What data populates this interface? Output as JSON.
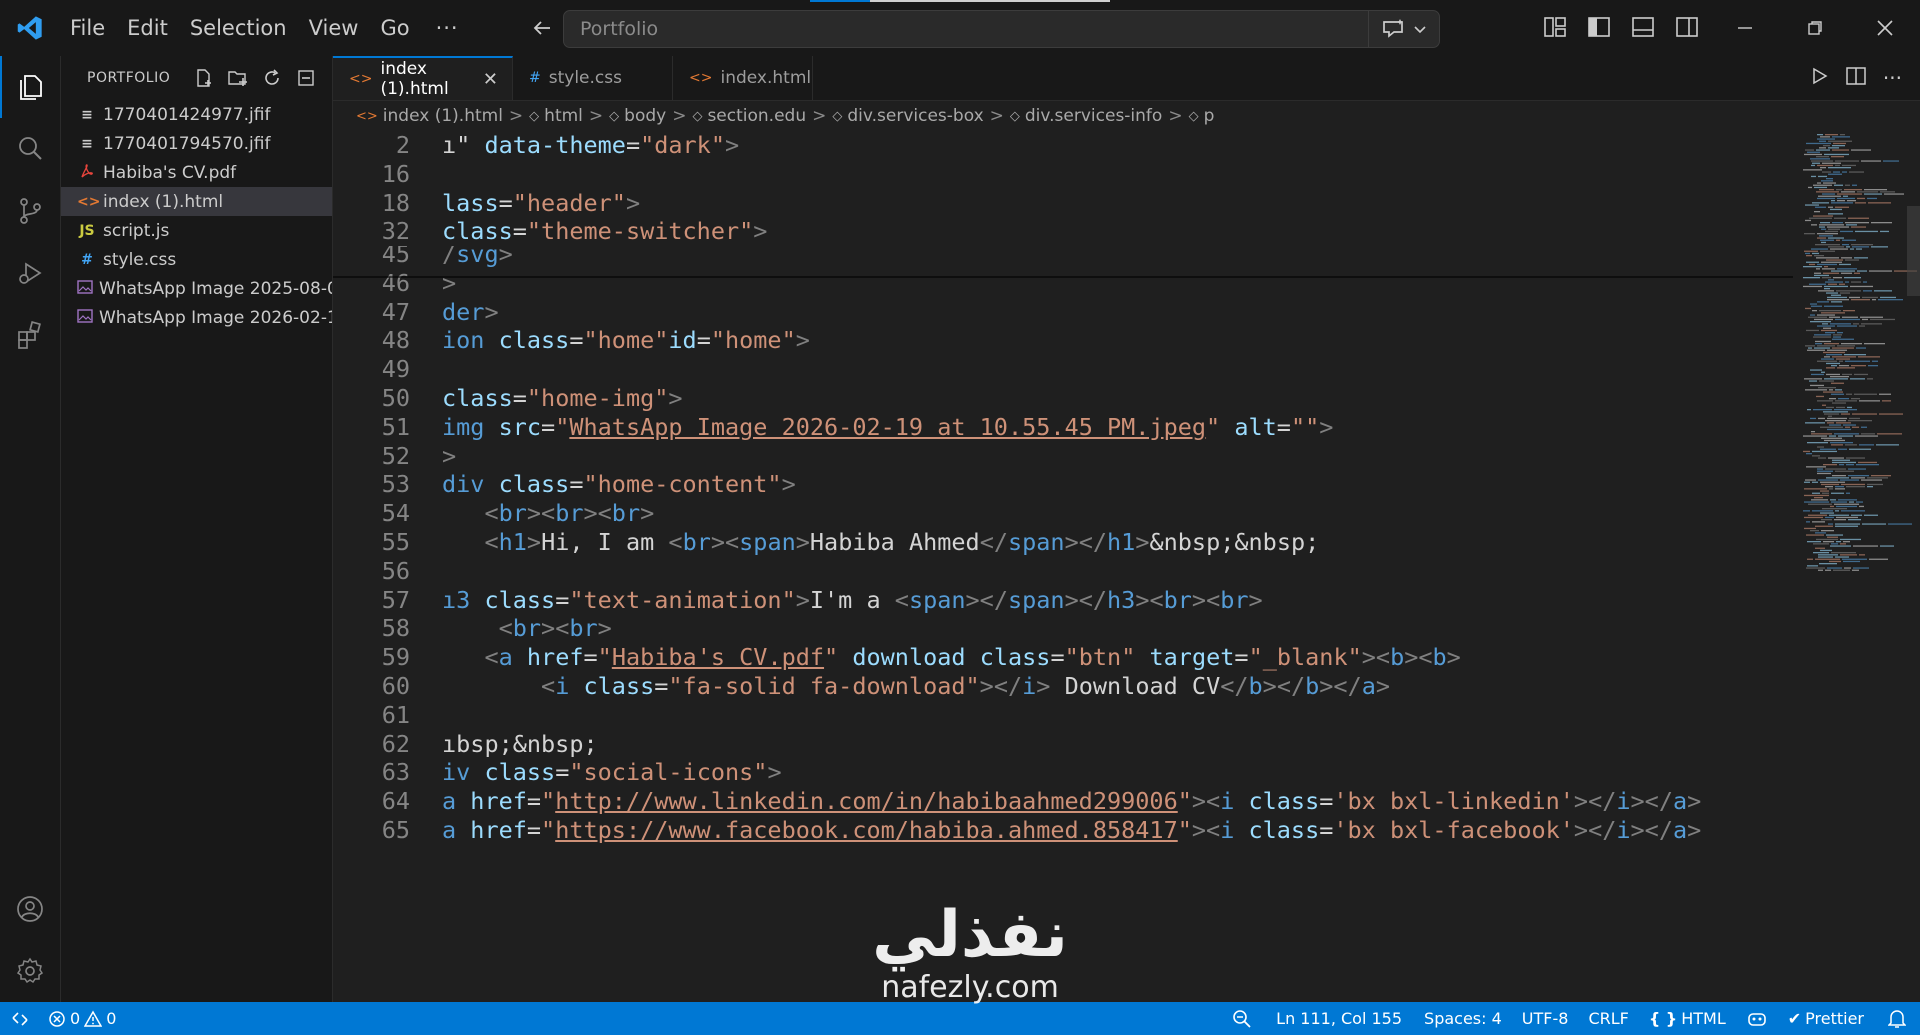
{
  "titlebar": {
    "menu": [
      "File",
      "Edit",
      "Selection",
      "View",
      "Go"
    ],
    "more": "···",
    "command_center": "Portfolio"
  },
  "sidebar": {
    "title": "PORTFOLIO",
    "files": [
      {
        "name": "1770401424977.jfif",
        "icon": "≡",
        "icon_color": "#cccccc"
      },
      {
        "name": "1770401794570.jfif",
        "icon": "≡",
        "icon_color": "#cccccc"
      },
      {
        "name": "Habiba's CV.pdf",
        "icon": "pdf-icon",
        "icon_color": "#e8453c"
      },
      {
        "name": "index (1).html",
        "icon": "<>",
        "icon_color": "#e37933",
        "selected": true
      },
      {
        "name": "script.js",
        "icon": "JS",
        "icon_color": "#cbcb41"
      },
      {
        "name": "style.css",
        "icon": "#",
        "icon_color": "#42a5f5"
      },
      {
        "name": "WhatsApp Image 2025-08-0...",
        "icon": "image-icon",
        "icon_color": "#a074c4"
      },
      {
        "name": "WhatsApp Image 2026-02-1...",
        "icon": "image-icon",
        "icon_color": "#a074c4"
      }
    ]
  },
  "tabs": [
    {
      "label": "index (1).html",
      "icon": "<>",
      "icon_color": "#e37933",
      "active": true,
      "close": "✕"
    },
    {
      "label": "style.css",
      "icon": "#",
      "icon_color": "#42a5f5",
      "active": false
    },
    {
      "label": "index.html",
      "icon": "<>",
      "icon_color": "#e37933",
      "active": false
    }
  ],
  "breadcrumbs": [
    {
      "label": "index (1).html",
      "icon": "<>"
    },
    {
      "label": "html",
      "icon": "◇"
    },
    {
      "label": "body",
      "icon": "◇"
    },
    {
      "label": "section.edu",
      "icon": "◇"
    },
    {
      "label": "div.services-box",
      "icon": "◇"
    },
    {
      "label": "div.services-info",
      "icon": "◇"
    },
    {
      "label": "p",
      "icon": "◇"
    }
  ],
  "code_lines": [
    {
      "num": "2",
      "tokens": [
        [
          "t",
          "ı\" "
        ],
        [
          "a",
          "data-theme"
        ],
        [
          "t",
          "="
        ],
        [
          "s",
          "\"dark\""
        ],
        [
          "b",
          ">"
        ]
      ]
    },
    {
      "num": "16",
      "tokens": []
    },
    {
      "num": "18",
      "tokens": [
        [
          "a",
          "lass"
        ],
        [
          "t",
          "="
        ],
        [
          "s",
          "\"header\""
        ],
        [
          "b",
          ">"
        ]
      ]
    },
    {
      "num": "32",
      "tokens": [
        [
          "a",
          "class"
        ],
        [
          "t",
          "="
        ],
        [
          "s",
          "\"theme-switcher\""
        ],
        [
          "b",
          ">"
        ]
      ]
    },
    {
      "num": "45",
      "tokens": [
        [
          "b",
          "/"
        ],
        [
          "g",
          "svg"
        ],
        [
          "b",
          ">"
        ]
      ]
    },
    {
      "num": "46",
      "tokens": [
        [
          "b",
          ">"
        ]
      ]
    },
    {
      "num": "47",
      "tokens": [
        [
          "g",
          "der"
        ],
        [
          "b",
          ">"
        ]
      ]
    },
    {
      "num": "48",
      "tokens": [
        [
          "g",
          "ion "
        ],
        [
          "a",
          "class"
        ],
        [
          "t",
          "="
        ],
        [
          "s",
          "\"home\""
        ],
        [
          "a",
          "id"
        ],
        [
          "t",
          "="
        ],
        [
          "s",
          "\"home\""
        ],
        [
          "b",
          ">"
        ]
      ]
    },
    {
      "num": "49",
      "tokens": []
    },
    {
      "num": "50",
      "tokens": [
        [
          "a",
          "class"
        ],
        [
          "t",
          "="
        ],
        [
          "s",
          "\"home-img\""
        ],
        [
          "b",
          ">"
        ]
      ]
    },
    {
      "num": "51",
      "tokens": [
        [
          "g",
          "img "
        ],
        [
          "a",
          "src"
        ],
        [
          "t",
          "="
        ],
        [
          "s",
          "\""
        ],
        [
          "l",
          "WhatsApp Image 2026-02-19 at 10.55.45 PM.jpeg"
        ],
        [
          "s",
          "\""
        ],
        [
          "t",
          " "
        ],
        [
          "a",
          "alt"
        ],
        [
          "t",
          "="
        ],
        [
          "s",
          "\"\""
        ],
        [
          "b",
          ">"
        ]
      ]
    },
    {
      "num": "52",
      "tokens": [
        [
          "b",
          ">"
        ]
      ]
    },
    {
      "num": "53",
      "tokens": [
        [
          "g",
          "div "
        ],
        [
          "a",
          "class"
        ],
        [
          "t",
          "="
        ],
        [
          "s",
          "\"home-content\""
        ],
        [
          "b",
          ">"
        ]
      ]
    },
    {
      "num": "54",
      "tokens": [
        [
          "t",
          "   "
        ],
        [
          "b",
          "<"
        ],
        [
          "g",
          "br"
        ],
        [
          "b",
          "><"
        ],
        [
          "g",
          "br"
        ],
        [
          "b",
          "><"
        ],
        [
          "g",
          "br"
        ],
        [
          "b",
          ">"
        ]
      ]
    },
    {
      "num": "55",
      "tokens": [
        [
          "t",
          "   "
        ],
        [
          "b",
          "<"
        ],
        [
          "g",
          "h1"
        ],
        [
          "b",
          ">"
        ],
        [
          "t",
          "Hi, I am "
        ],
        [
          "b",
          "<"
        ],
        [
          "g",
          "br"
        ],
        [
          "b",
          "><"
        ],
        [
          "g",
          "span"
        ],
        [
          "b",
          ">"
        ],
        [
          "t",
          "Habiba Ahmed"
        ],
        [
          "b",
          "</"
        ],
        [
          "g",
          "span"
        ],
        [
          "b",
          "></"
        ],
        [
          "g",
          "h1"
        ],
        [
          "b",
          ">"
        ],
        [
          "t",
          "&nbsp;&nbsp;"
        ]
      ]
    },
    {
      "num": "56",
      "tokens": []
    },
    {
      "num": "57",
      "tokens": [
        [
          "g",
          "ı3 "
        ],
        [
          "a",
          "class"
        ],
        [
          "t",
          "="
        ],
        [
          "s",
          "\"text-animation\""
        ],
        [
          "b",
          ">"
        ],
        [
          "t",
          "I'm a "
        ],
        [
          "b",
          "<"
        ],
        [
          "g",
          "span"
        ],
        [
          "b",
          "></"
        ],
        [
          "g",
          "span"
        ],
        [
          "b",
          "></"
        ],
        [
          "g",
          "h3"
        ],
        [
          "b",
          "><"
        ],
        [
          "g",
          "br"
        ],
        [
          "b",
          "><"
        ],
        [
          "g",
          "br"
        ],
        [
          "b",
          ">"
        ]
      ]
    },
    {
      "num": "58",
      "tokens": [
        [
          "t",
          "    "
        ],
        [
          "b",
          "<"
        ],
        [
          "g",
          "br"
        ],
        [
          "b",
          "><"
        ],
        [
          "g",
          "br"
        ],
        [
          "b",
          ">"
        ]
      ]
    },
    {
      "num": "59",
      "tokens": [
        [
          "t",
          "   "
        ],
        [
          "b",
          "<"
        ],
        [
          "g",
          "a "
        ],
        [
          "a",
          "href"
        ],
        [
          "t",
          "="
        ],
        [
          "s",
          "\""
        ],
        [
          "l",
          "Habiba's CV.pdf"
        ],
        [
          "s",
          "\""
        ],
        [
          "t",
          " "
        ],
        [
          "a",
          "download "
        ],
        [
          "a",
          "class"
        ],
        [
          "t",
          "="
        ],
        [
          "s",
          "\"btn\""
        ],
        [
          "t",
          " "
        ],
        [
          "a",
          "target"
        ],
        [
          "t",
          "="
        ],
        [
          "s",
          "\"_blank\""
        ],
        [
          "b",
          ">"
        ],
        [
          "b",
          "<"
        ],
        [
          "g",
          "b"
        ],
        [
          "b",
          "><"
        ],
        [
          "g",
          "b"
        ],
        [
          "b",
          ">"
        ]
      ]
    },
    {
      "num": "60",
      "tokens": [
        [
          "t",
          "       "
        ],
        [
          "b",
          "<"
        ],
        [
          "g",
          "i "
        ],
        [
          "a",
          "class"
        ],
        [
          "t",
          "="
        ],
        [
          "s",
          "\"fa-solid fa-download\""
        ],
        [
          "b",
          "></"
        ],
        [
          "g",
          "i"
        ],
        [
          "b",
          ">"
        ],
        [
          "t",
          " Download CV"
        ],
        [
          "b",
          "</"
        ],
        [
          "g",
          "b"
        ],
        [
          "b",
          "></"
        ],
        [
          "g",
          "b"
        ],
        [
          "b",
          "></"
        ],
        [
          "g",
          "a"
        ],
        [
          "b",
          ">"
        ]
      ]
    },
    {
      "num": "61",
      "tokens": []
    },
    {
      "num": "62",
      "tokens": [
        [
          "t",
          "ıbsp;&nbsp;"
        ]
      ]
    },
    {
      "num": "63",
      "tokens": [
        [
          "g",
          "iv "
        ],
        [
          "a",
          "class"
        ],
        [
          "t",
          "="
        ],
        [
          "s",
          "\"social-icons\""
        ],
        [
          "b",
          ">"
        ]
      ]
    },
    {
      "num": "64",
      "tokens": [
        [
          "g",
          "a "
        ],
        [
          "a",
          "href"
        ],
        [
          "t",
          "="
        ],
        [
          "s",
          "\""
        ],
        [
          "l",
          "http://www.linkedin.com/in/habibaahmed299006"
        ],
        [
          "s",
          "\""
        ],
        [
          "b",
          "><"
        ],
        [
          "g",
          "i "
        ],
        [
          "a",
          "class"
        ],
        [
          "t",
          "="
        ],
        [
          "s",
          "'bx bxl-linkedin'"
        ],
        [
          "b",
          "></"
        ],
        [
          "g",
          "i"
        ],
        [
          "b",
          "></"
        ],
        [
          "g",
          "a"
        ],
        [
          "b",
          ">"
        ]
      ]
    },
    {
      "num": "65",
      "tokens": [
        [
          "g",
          "a "
        ],
        [
          "a",
          "href"
        ],
        [
          "t",
          "="
        ],
        [
          "s",
          "\""
        ],
        [
          "l",
          "https://www.facebook.com/habiba.ahmed.858417"
        ],
        [
          "s",
          "\""
        ],
        [
          "b",
          "><"
        ],
        [
          "g",
          "i "
        ],
        [
          "a",
          "class"
        ],
        [
          "t",
          "="
        ],
        [
          "s",
          "'bx bxl-facebook'"
        ],
        [
          "b",
          "></"
        ],
        [
          "g",
          "i"
        ],
        [
          "b",
          "></"
        ],
        [
          "g",
          "a"
        ],
        [
          "b",
          ">"
        ]
      ]
    }
  ],
  "statusbar": {
    "errors": "0",
    "warnings": "0",
    "position": "Ln 111, Col 155",
    "spaces": "Spaces: 4",
    "encoding": "UTF-8",
    "eol": "CRLF",
    "language": "HTML",
    "formatter": "Prettier"
  },
  "watermark": {
    "arabic": "نفذلي",
    "latin": "nafezly.com"
  },
  "colors": {
    "accent": "#0078d4",
    "statusbar": "#0078d4",
    "editor_bg": "#1f1f1f",
    "sidebar_bg": "#181818"
  }
}
